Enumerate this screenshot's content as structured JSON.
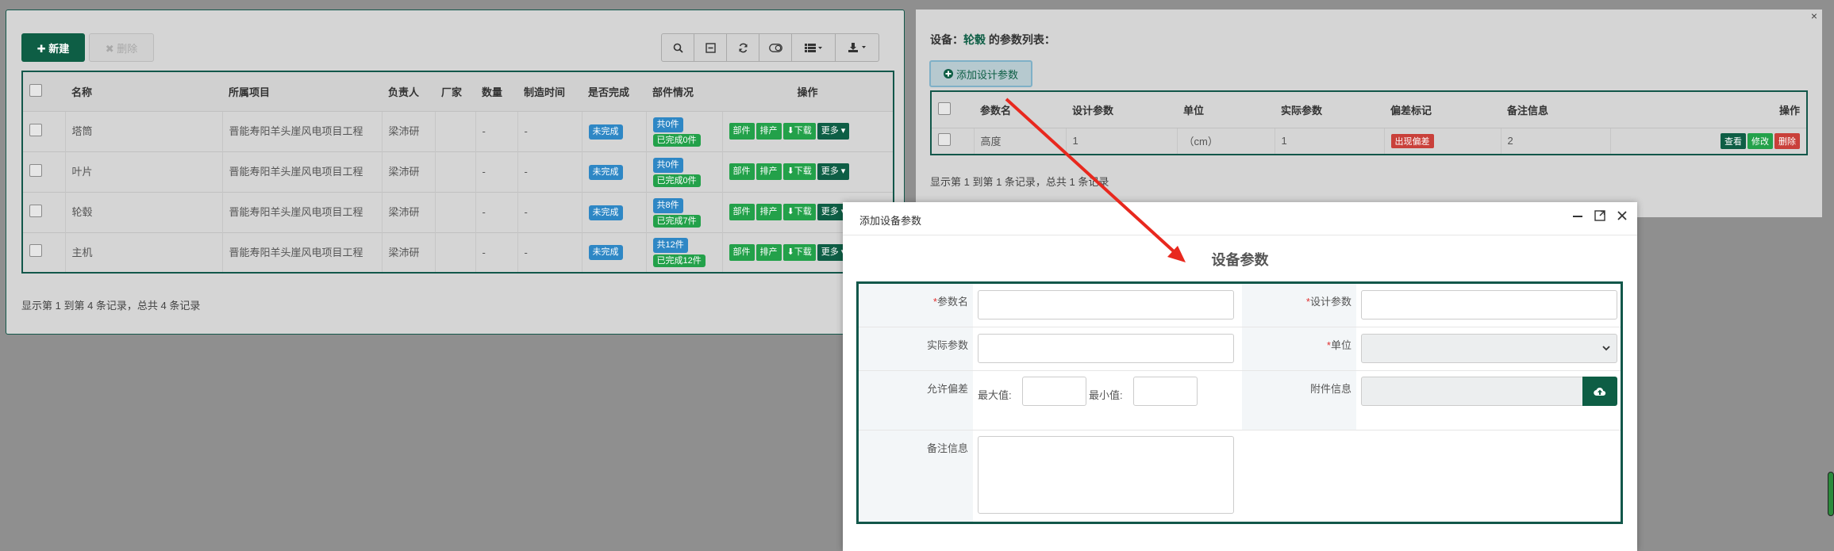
{
  "left": {
    "new_label": "✚ 新建",
    "del_label": "✖ 删除",
    "toolbar": [
      "search-icon",
      "form-icon",
      "refresh-icon",
      "toggle-icon",
      "columns-icon",
      "export-icon"
    ],
    "headers": [
      "名称",
      "所属项目",
      "负责人",
      "厂家",
      "数量",
      "制造时间",
      "是否完成",
      "部件情况",
      "操作"
    ],
    "rows": [
      {
        "name": "塔筒",
        "project": "晋能寿阳羊头崖风电项目工程",
        "owner": "梁沛研",
        "vendor": "",
        "qty": "-",
        "date": "-",
        "status": "未完成",
        "total": "共0件",
        "done": "已完成0件"
      },
      {
        "name": "叶片",
        "project": "晋能寿阳羊头崖风电项目工程",
        "owner": "梁沛研",
        "vendor": "",
        "qty": "-",
        "date": "-",
        "status": "未完成",
        "total": "共0件",
        "done": "已完成0件"
      },
      {
        "name": "轮毂",
        "project": "晋能寿阳羊头崖风电项目工程",
        "owner": "梁沛研",
        "vendor": "",
        "qty": "-",
        "date": "-",
        "status": "未完成",
        "total": "共8件",
        "done": "已完成7件"
      },
      {
        "name": "主机",
        "project": "晋能寿阳羊头崖风电项目工程",
        "owner": "梁沛研",
        "vendor": "",
        "qty": "-",
        "date": "-",
        "status": "未完成",
        "total": "共12件",
        "done": "已完成12件"
      }
    ],
    "actions": [
      "部件",
      "排产",
      "下载",
      "更多"
    ],
    "footer": "显示第 1 到第 4 条记录，总共 4 条记录"
  },
  "right": {
    "title_prefix": "设备：",
    "title_link": "轮毂",
    "title_suffix": " 的参数列表：",
    "add_label": "添加设计参数",
    "headers": [
      "参数名",
      "设计参数",
      "单位",
      "实际参数",
      "偏差标记",
      "备注信息",
      "操作"
    ],
    "row": {
      "name": "高度",
      "design": "1",
      "unit": "（cm）",
      "actual": "1",
      "flag": "出现偏差",
      "note": "2"
    },
    "row_actions": [
      "查看",
      "修改",
      "删除"
    ],
    "footer": "显示第 1 到第 1 条记录，总共 1 条记录",
    "close": "×"
  },
  "modal": {
    "title": "添加设备参数",
    "subtitle": "设备参数",
    "labels": {
      "param_name": "参数名",
      "design_param": "设计参数",
      "actual_param": "实际参数",
      "unit": "单位",
      "tolerance": "允许偏差",
      "attachment": "附件信息",
      "remark": "备注信息",
      "max": "最大值:",
      "min": "最小值:"
    },
    "required_mark": "*"
  }
}
